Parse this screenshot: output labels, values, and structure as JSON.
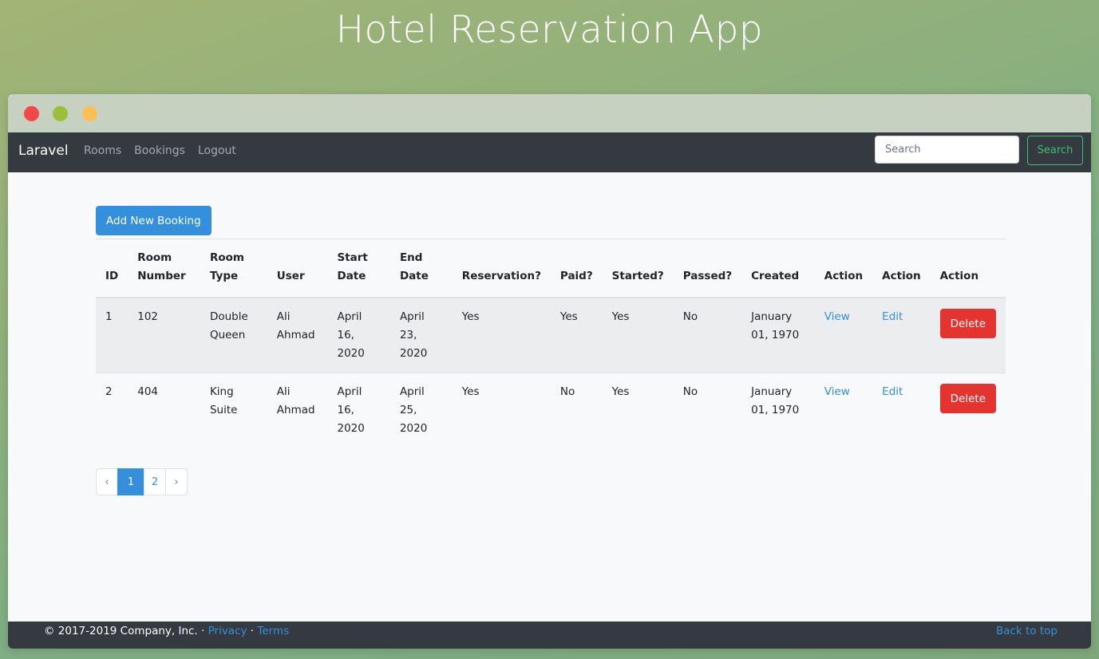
{
  "banner": {
    "title": "Hotel Reservation App"
  },
  "navbar": {
    "brand": "Laravel",
    "links": [
      "Rooms",
      "Bookings",
      "Logout"
    ],
    "search_placeholder": "Search",
    "search_button": "Search"
  },
  "main": {
    "add_button": "Add New Booking",
    "table": {
      "headers": [
        "ID",
        "Room Number",
        "Room Type",
        "User",
        "Start Date",
        "End Date",
        "Reservation?",
        "Paid?",
        "Started?",
        "Passed?",
        "Created",
        "Action",
        "Action",
        "Action"
      ],
      "rows": [
        {
          "id": "1",
          "room_number": "102",
          "room_type": "Double Queen",
          "user": "Ali Ahmad",
          "start_date": "April 16, 2020",
          "end_date": "April 23, 2020",
          "reservation": "Yes",
          "paid": "Yes",
          "started": "Yes",
          "passed": "No",
          "created": "January 01, 1970",
          "view": "View",
          "edit": "Edit",
          "delete": "Delete"
        },
        {
          "id": "2",
          "room_number": "404",
          "room_type": "King Suite",
          "user": "Ali Ahmad",
          "start_date": "April 16, 2020",
          "end_date": "April 25, 2020",
          "reservation": "Yes",
          "paid": "No",
          "started": "Yes",
          "passed": "No",
          "created": "January 01, 1970",
          "view": "View",
          "edit": "Edit",
          "delete": "Delete"
        }
      ]
    },
    "pagination": {
      "prev": "‹",
      "pages": [
        "1",
        "2"
      ],
      "next": "›",
      "current": "1"
    }
  },
  "footer": {
    "copyright": "© 2017-2019 Company, Inc. · ",
    "privacy": "Privacy",
    "separator": " · ",
    "terms": "Terms",
    "back_to_top": "Back to top"
  },
  "colors": {
    "primary": "#3490dc",
    "danger": "#e3342f",
    "success": "#38c172",
    "navbar": "#343a40"
  }
}
